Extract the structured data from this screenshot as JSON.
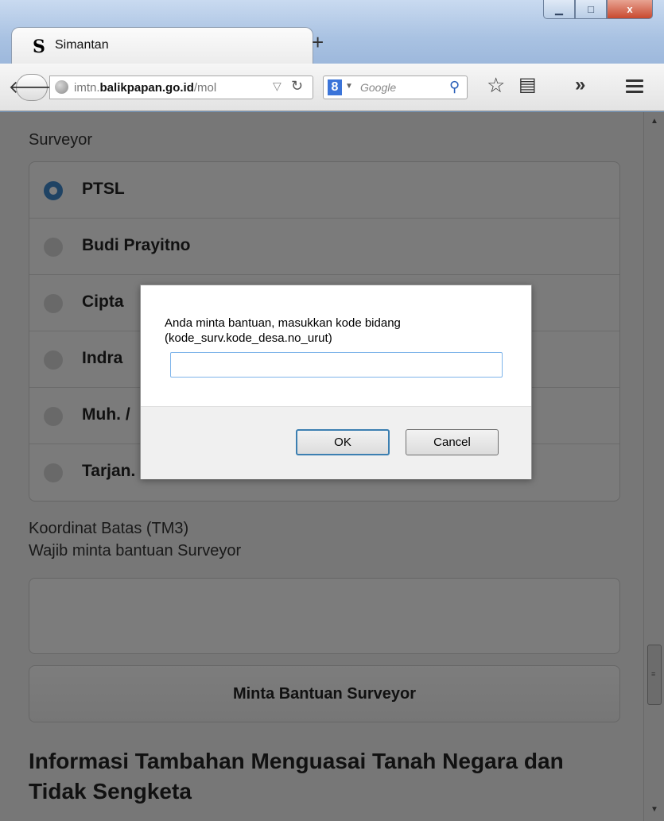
{
  "browser": {
    "tab_title": "Simantan",
    "tab_logo": "S",
    "new_tab": "+",
    "url_prefix": "imtn.",
    "url_domain": "balikpapan.go.id",
    "url_suffix": "/mol",
    "search_engine_icon": "8",
    "search_placeholder": "Google",
    "window_buttons": {
      "minimize": "▁",
      "maximize": "□",
      "close": "x"
    }
  },
  "page": {
    "surveyor_label": "Surveyor",
    "surveyor_options": [
      {
        "label": "PTSL",
        "selected": true
      },
      {
        "label": "Budi Prayitno",
        "selected": false
      },
      {
        "label": "Cipta",
        "selected": false
      },
      {
        "label": "Indra",
        "selected": false
      },
      {
        "label": "Muh. /",
        "selected": false
      },
      {
        "label": "Tarjan.",
        "selected": false
      }
    ],
    "coord_label": "Koordinat Batas (TM3)",
    "coord_note": "Wajib minta bantuan Surveyor",
    "coord_value": "",
    "help_button": "Minta Bantuan Surveyor",
    "info_title": "Informasi Tambahan Menguasai Tanah Negara dan Tidak Sengketa"
  },
  "dialog": {
    "message_line1": "Anda minta bantuan, masukkan kode bidang",
    "message_line2": "(kode_surv.kode_desa.no_urut)",
    "input_value": "",
    "ok_label": "OK",
    "cancel_label": "Cancel"
  },
  "colors": {
    "radio_selected": "#3e86c9",
    "focus_border": "#7eb4ea",
    "overlay": "rgba(0,0,0,0.5)"
  },
  "icons": [
    "back-arrow-icon",
    "globe-icon",
    "dropdown-triangle-icon",
    "reload-icon",
    "google-search-icon",
    "magnifier-icon",
    "star-icon",
    "reader-icon",
    "overflow-chevron-icon",
    "hamburger-menu-icon",
    "radio-icon"
  ]
}
